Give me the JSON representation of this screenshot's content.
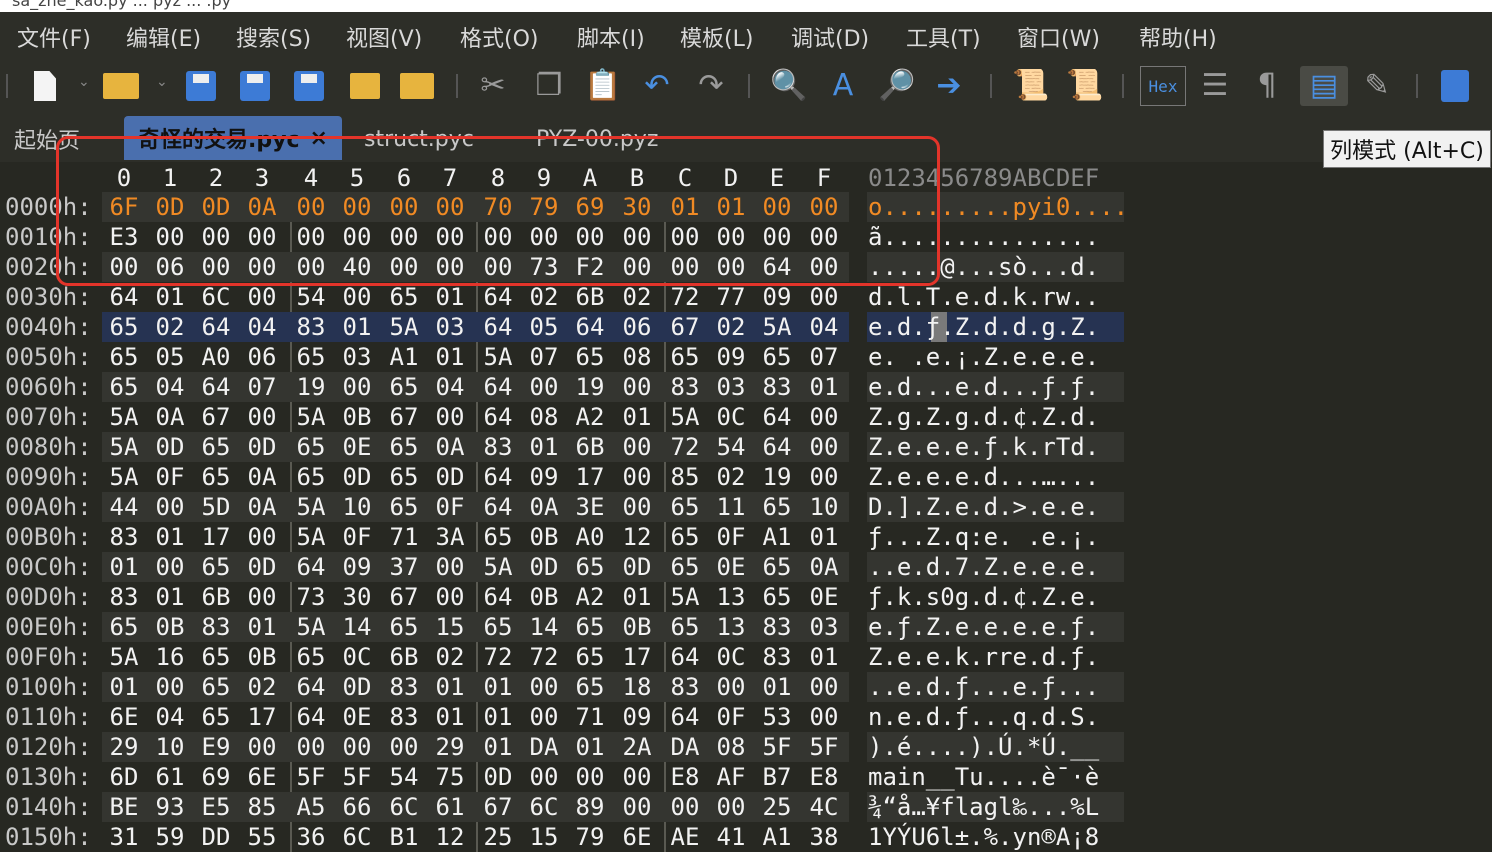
{
  "titlebar": {
    "text": "sa_zhe_kao.py ... pyz ... .py"
  },
  "menu": [
    "文件(F)",
    "编辑(E)",
    "搜索(S)",
    "视图(V)",
    "格式(O)",
    "脚本(I)",
    "模板(L)",
    "调试(D)",
    "工具(T)",
    "窗口(W)",
    "帮助(H)"
  ],
  "tabs": [
    {
      "label": "起始页",
      "active": false
    },
    {
      "label": "奇怪的交易.pyc",
      "active": true,
      "close": "×"
    },
    {
      "label": "struct.pyc",
      "active": false
    },
    {
      "label": "PYZ-00.pyz",
      "active": false
    }
  ],
  "toolbar": {
    "hex_label": "Hex",
    "pilcrow": "¶"
  },
  "tooltip": "列模式 (Alt+C)",
  "hex_header": {
    "columns": [
      "0",
      "1",
      "2",
      "3",
      "4",
      "5",
      "6",
      "7",
      "8",
      "9",
      "A",
      "B",
      "C",
      "D",
      "E",
      "F"
    ],
    "ascii": "0123456789ABCDEF"
  },
  "rows": [
    {
      "offset": "0000h:",
      "bytes": [
        "6F",
        "0D",
        "0D",
        "0A",
        "00",
        "00",
        "00",
        "00",
        "70",
        "79",
        "69",
        "30",
        "01",
        "01",
        "00",
        "00"
      ],
      "ascii": "o.........pyi0...."
    },
    {
      "offset": "0010h:",
      "bytes": [
        "E3",
        "00",
        "00",
        "00",
        "00",
        "00",
        "00",
        "00",
        "00",
        "00",
        "00",
        "00",
        "00",
        "00",
        "00",
        "00"
      ],
      "ascii": "ã..............."
    },
    {
      "offset": "0020h:",
      "bytes": [
        "00",
        "06",
        "00",
        "00",
        "00",
        "40",
        "00",
        "00",
        "00",
        "73",
        "F2",
        "00",
        "00",
        "00",
        "64",
        "00"
      ],
      "ascii": ".....@...sò...d."
    },
    {
      "offset": "0030h:",
      "bytes": [
        "64",
        "01",
        "6C",
        "00",
        "54",
        "00",
        "65",
        "01",
        "64",
        "02",
        "6B",
        "02",
        "72",
        "77",
        "09",
        "00"
      ],
      "ascii": "d.l.T.e.d.k.rw.."
    },
    {
      "offset": "0040h:",
      "bytes": [
        "65",
        "02",
        "64",
        "04",
        "83",
        "01",
        "5A",
        "03",
        "64",
        "05",
        "64",
        "06",
        "67",
        "02",
        "5A",
        "04"
      ],
      "ascii": "e.d.ƒ.Z.d.d.g.Z."
    },
    {
      "offset": "0050h:",
      "bytes": [
        "65",
        "05",
        "A0",
        "06",
        "65",
        "03",
        "A1",
        "01",
        "5A",
        "07",
        "65",
        "08",
        "65",
        "09",
        "65",
        "07"
      ],
      "ascii": "e. .e.¡.Z.e.e.e."
    },
    {
      "offset": "0060h:",
      "bytes": [
        "65",
        "04",
        "64",
        "07",
        "19",
        "00",
        "65",
        "04",
        "64",
        "00",
        "19",
        "00",
        "83",
        "03",
        "83",
        "01"
      ],
      "ascii": "e.d...e.d...ƒ.ƒ."
    },
    {
      "offset": "0070h:",
      "bytes": [
        "5A",
        "0A",
        "67",
        "00",
        "5A",
        "0B",
        "67",
        "00",
        "64",
        "08",
        "A2",
        "01",
        "5A",
        "0C",
        "64",
        "00"
      ],
      "ascii": "Z.g.Z.g.d.¢.Z.d."
    },
    {
      "offset": "0080h:",
      "bytes": [
        "5A",
        "0D",
        "65",
        "0D",
        "65",
        "0E",
        "65",
        "0A",
        "83",
        "01",
        "6B",
        "00",
        "72",
        "54",
        "64",
        "00"
      ],
      "ascii": "Z.e.e.e.ƒ.k.rTd."
    },
    {
      "offset": "0090h:",
      "bytes": [
        "5A",
        "0F",
        "65",
        "0A",
        "65",
        "0D",
        "65",
        "0D",
        "64",
        "09",
        "17",
        "00",
        "85",
        "02",
        "19",
        "00"
      ],
      "ascii": "Z.e.e.e.d...…..."
    },
    {
      "offset": "00A0h:",
      "bytes": [
        "44",
        "00",
        "5D",
        "0A",
        "5A",
        "10",
        "65",
        "0F",
        "64",
        "0A",
        "3E",
        "00",
        "65",
        "11",
        "65",
        "10"
      ],
      "ascii": "D.].Z.e.d.>.e.e."
    },
    {
      "offset": "00B0h:",
      "bytes": [
        "83",
        "01",
        "17",
        "00",
        "5A",
        "0F",
        "71",
        "3A",
        "65",
        "0B",
        "A0",
        "12",
        "65",
        "0F",
        "A1",
        "01"
      ],
      "ascii": "ƒ...Z.q:e. .e.¡."
    },
    {
      "offset": "00C0h:",
      "bytes": [
        "01",
        "00",
        "65",
        "0D",
        "64",
        "09",
        "37",
        "00",
        "5A",
        "0D",
        "65",
        "0D",
        "65",
        "0E",
        "65",
        "0A"
      ],
      "ascii": "..e.d.7.Z.e.e.e."
    },
    {
      "offset": "00D0h:",
      "bytes": [
        "83",
        "01",
        "6B",
        "00",
        "73",
        "30",
        "67",
        "00",
        "64",
        "0B",
        "A2",
        "01",
        "5A",
        "13",
        "65",
        "0E"
      ],
      "ascii": "ƒ.k.s0g.d.¢.Z.e."
    },
    {
      "offset": "00E0h:",
      "bytes": [
        "65",
        "0B",
        "83",
        "01",
        "5A",
        "14",
        "65",
        "15",
        "65",
        "14",
        "65",
        "0B",
        "65",
        "13",
        "83",
        "03"
      ],
      "ascii": "e.ƒ.Z.e.e.e.e.ƒ."
    },
    {
      "offset": "00F0h:",
      "bytes": [
        "5A",
        "16",
        "65",
        "0B",
        "65",
        "0C",
        "6B",
        "02",
        "72",
        "72",
        "65",
        "17",
        "64",
        "0C",
        "83",
        "01"
      ],
      "ascii": "Z.e.e.k.rre.d.ƒ."
    },
    {
      "offset": "0100h:",
      "bytes": [
        "01",
        "00",
        "65",
        "02",
        "64",
        "0D",
        "83",
        "01",
        "01",
        "00",
        "65",
        "18",
        "83",
        "00",
        "01",
        "00"
      ],
      "ascii": "..e.d.ƒ...e.ƒ..."
    },
    {
      "offset": "0110h:",
      "bytes": [
        "6E",
        "04",
        "65",
        "17",
        "64",
        "0E",
        "83",
        "01",
        "01",
        "00",
        "71",
        "09",
        "64",
        "0F",
        "53",
        "00"
      ],
      "ascii": "n.e.d.ƒ...q.d.S."
    },
    {
      "offset": "0120h:",
      "bytes": [
        "29",
        "10",
        "E9",
        "00",
        "00",
        "00",
        "00",
        "29",
        "01",
        "DA",
        "01",
        "2A",
        "DA",
        "08",
        "5F",
        "5F"
      ],
      "ascii": ").é....).Ú.*Ú.__"
    },
    {
      "offset": "0130h:",
      "bytes": [
        "6D",
        "61",
        "69",
        "6E",
        "5F",
        "5F",
        "54",
        "75",
        "0D",
        "00",
        "00",
        "00",
        "E8",
        "AF",
        "B7",
        "E8"
      ],
      "ascii": "main__Tu....è¯·è"
    },
    {
      "offset": "0140h:",
      "bytes": [
        "BE",
        "93",
        "E5",
        "85",
        "A5",
        "66",
        "6C",
        "61",
        "67",
        "6C",
        "89",
        "00",
        "00",
        "00",
        "25",
        "4C"
      ],
      "ascii": "¾“å…¥flagl‰...%L"
    },
    {
      "offset": "0150h:",
      "bytes": [
        "31",
        "59",
        "DD",
        "55",
        "36",
        "6C",
        "B1",
        "12",
        "25",
        "15",
        "79",
        "6E",
        "AE",
        "41",
        "A1",
        "38"
      ],
      "ascii": "1YÝU6l±.%.yn®A¡8"
    }
  ]
}
